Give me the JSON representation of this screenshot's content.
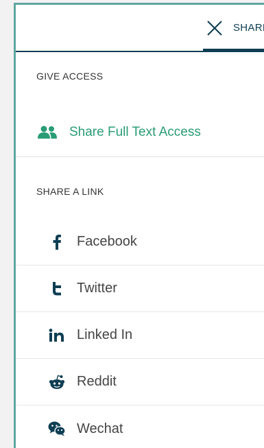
{
  "header": {
    "tab_label": "SHARE",
    "close_icon": "close-icon"
  },
  "give_access": {
    "title": "GIVE ACCESS",
    "item": {
      "label": "Share Full Text Access",
      "icon": "users-icon"
    }
  },
  "share_link": {
    "title": "SHARE A LINK",
    "items": [
      {
        "label": "Facebook",
        "icon": "facebook-icon"
      },
      {
        "label": "Twitter",
        "icon": "twitter-icon"
      },
      {
        "label": "Linked In",
        "icon": "linkedin-icon"
      },
      {
        "label": "Reddit",
        "icon": "reddit-icon"
      },
      {
        "label": "Wechat",
        "icon": "wechat-icon"
      }
    ]
  },
  "colors": {
    "accent_navy": "#0e3e53",
    "accent_green": "#2a9c76",
    "panel_border": "#5fa6a1"
  }
}
